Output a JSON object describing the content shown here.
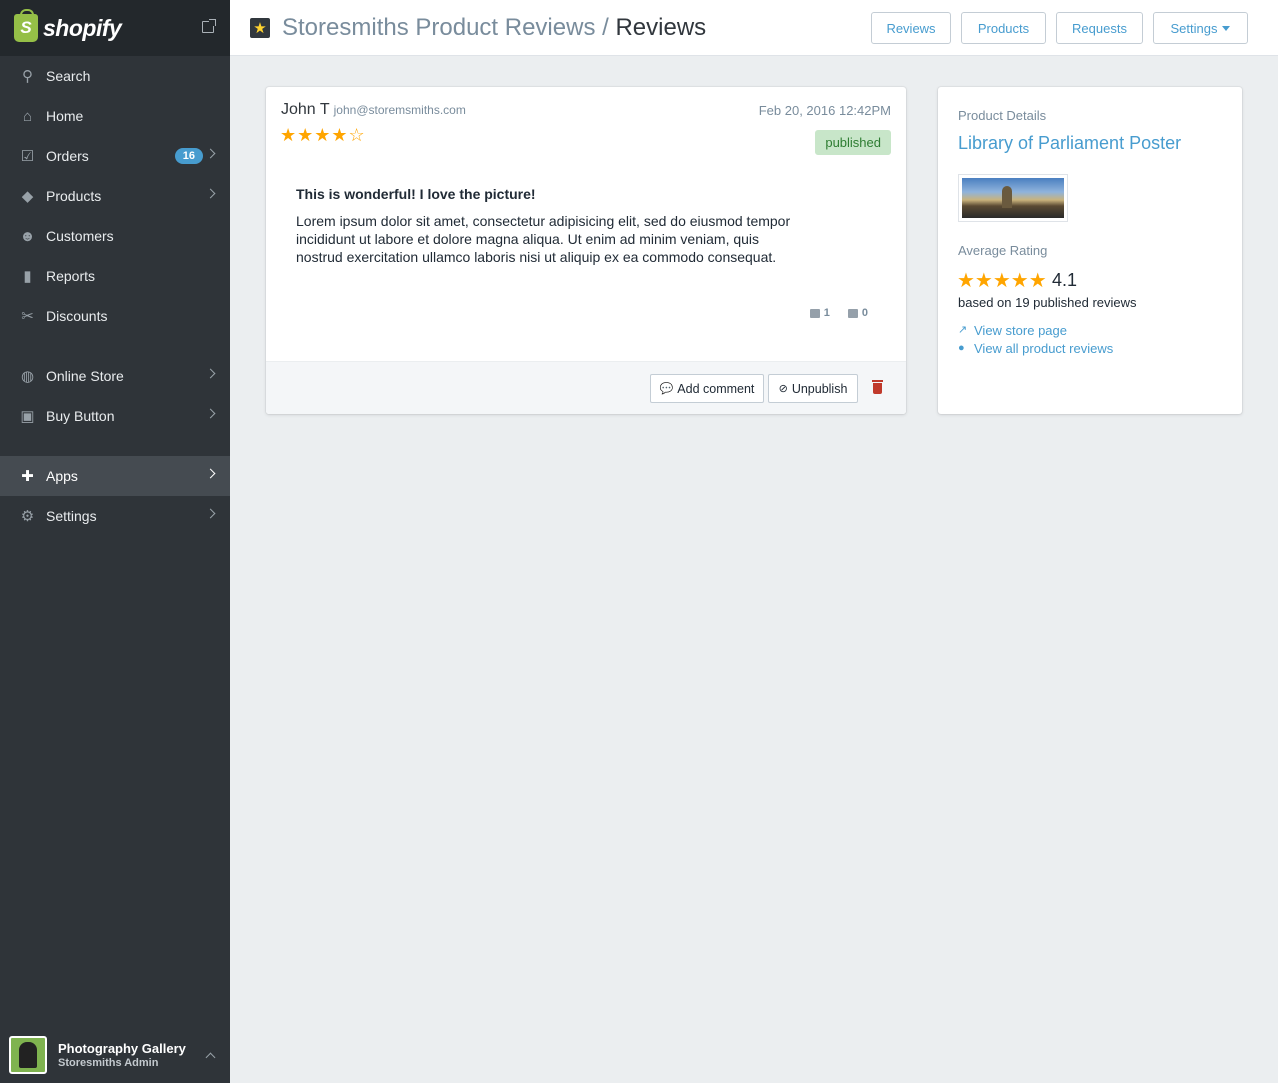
{
  "sidebar": {
    "brand": "shopify",
    "items": [
      {
        "label": "Search",
        "icon": "search-icon"
      },
      {
        "label": "Home",
        "icon": "home-icon"
      },
      {
        "label": "Orders",
        "icon": "orders-icon",
        "badge": "16"
      },
      {
        "label": "Products",
        "icon": "tag-icon"
      },
      {
        "label": "Customers",
        "icon": "customers-icon"
      },
      {
        "label": "Reports",
        "icon": "reports-icon"
      },
      {
        "label": "Discounts",
        "icon": "discounts-icon"
      },
      {
        "label": "Online Store",
        "icon": "globe-icon"
      },
      {
        "label": "Buy Button",
        "icon": "buy-button-icon"
      },
      {
        "label": "Apps",
        "icon": "puzzle-icon",
        "active": true
      },
      {
        "label": "Settings",
        "icon": "gear-icon"
      }
    ],
    "store": {
      "name": "Photography Gallery",
      "role": "Storesmiths Admin"
    }
  },
  "header": {
    "app_name": "Storesmiths Product Reviews",
    "separator": "/",
    "current_page": "Reviews",
    "buttons": {
      "reviews": "Reviews",
      "products": "Products",
      "requests": "Requests",
      "settings": "Settings"
    }
  },
  "review": {
    "author": "John T",
    "email": "john@storemsmiths.com",
    "date": "Feb 20, 2016 12:42PM",
    "rating": 4,
    "stars": "★★★★☆",
    "status": "published",
    "title": "This is wonderful! I love the picture!",
    "body": "Lorem ipsum dolor sit amet, consectetur adipisicing elit, sed do eiusmod tempor incididunt ut labore et dolore magna aliqua. Ut enim ad minim veniam, quis nostrud exercitation ullamco laboris nisi ut aliquip ex ea commodo consequat.",
    "upvotes": "1",
    "downvotes": "0",
    "actions": {
      "add_comment": "Add comment",
      "unpublish": "Unpublish"
    }
  },
  "product": {
    "section_label": "Product Details",
    "name": "Library of Parliament Poster",
    "avg_label": "Average Rating",
    "avg_stars": "★★★★★",
    "avg_rating": "4.1",
    "count_text": "based on 19 published reviews",
    "view_store": "View store page",
    "view_all": "View all product reviews"
  },
  "colors": {
    "accent": "#479ccf",
    "sidebar": "#2f3439",
    "star": "#ffa500",
    "published_bg": "#c8e6c9"
  }
}
